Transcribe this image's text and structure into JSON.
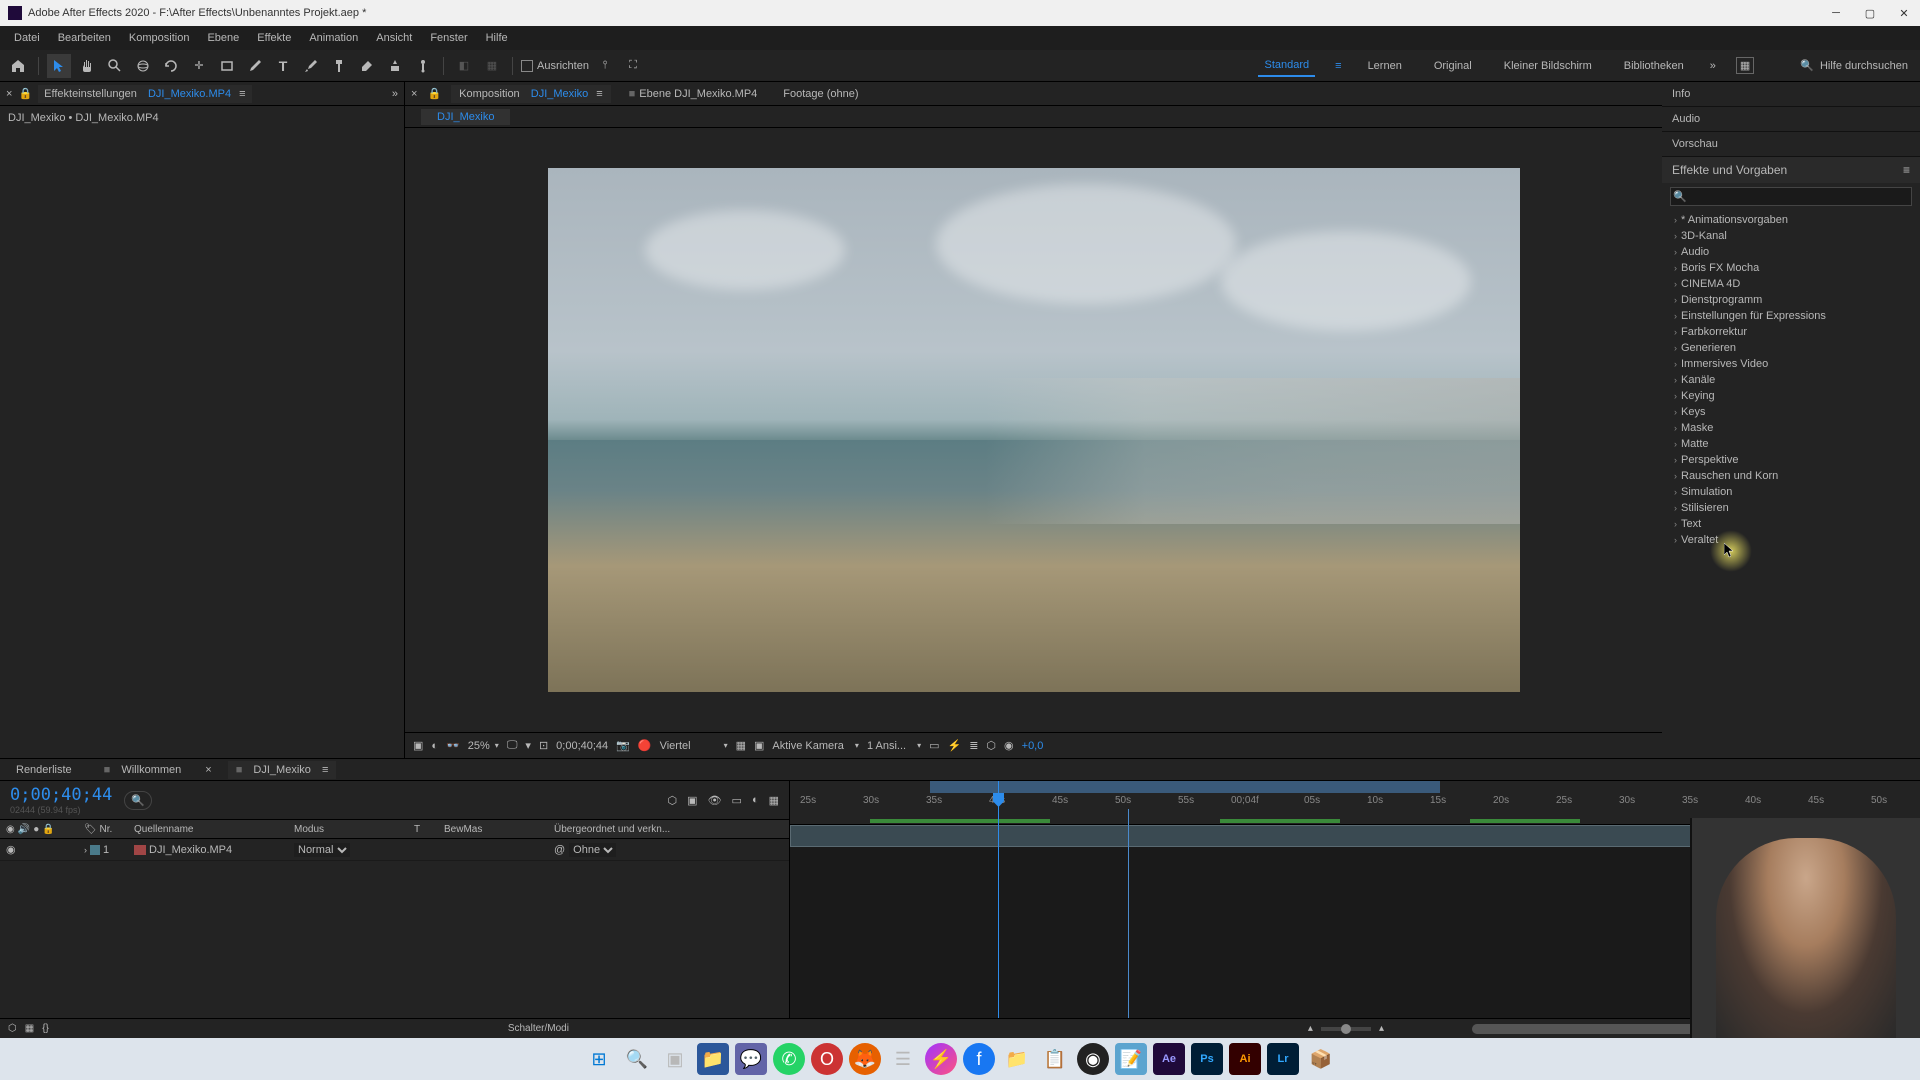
{
  "titlebar": {
    "title": "Adobe After Effects 2020 - F:\\After Effects\\Unbenanntes Projekt.aep *"
  },
  "menu": {
    "items": [
      "Datei",
      "Bearbeiten",
      "Komposition",
      "Ebene",
      "Effekte",
      "Animation",
      "Ansicht",
      "Fenster",
      "Hilfe"
    ]
  },
  "toolbar": {
    "snapping": "Ausrichten",
    "workspaces": [
      "Standard",
      "Lernen",
      "Original",
      "Kleiner Bildschirm",
      "Bibliotheken"
    ],
    "search_placeholder": "Hilfe durchsuchen"
  },
  "left_panel": {
    "tab1_prefix": "Effekteinstellungen",
    "tab1_file": "DJI_Mexiko.MP4",
    "breadcrumb": "DJI_Mexiko • DJI_Mexiko.MP4"
  },
  "comp_panel": {
    "tab_comp_prefix": "Komposition",
    "tab_comp_file": "DJI_Mexiko",
    "tab_layer": "Ebene DJI_Mexiko.MP4",
    "tab_footage": "Footage  (ohne)",
    "sub_tab": "DJI_Mexiko"
  },
  "viewer_controls": {
    "zoom": "25%",
    "timecode": "0;00;40;44",
    "resolution": "Viertel",
    "camera": "Aktive Kamera",
    "views": "1 Ansi...",
    "exposure": "+0,0"
  },
  "right_panel": {
    "sections": [
      "Info",
      "Audio",
      "Vorschau"
    ],
    "effects_header": "Effekte und Vorgaben",
    "categories": [
      "* Animationsvorgaben",
      "3D-Kanal",
      "Audio",
      "Boris FX Mocha",
      "CINEMA 4D",
      "Dienstprogramm",
      "Einstellungen für Expressions",
      "Farbkorrektur",
      "Generieren",
      "Immersives Video",
      "Kanäle",
      "Keying",
      "Keys",
      "Maske",
      "Matte",
      "Perspektive",
      "Rauschen und Korn",
      "Simulation",
      "Stilisieren",
      "Text",
      "Veraltet"
    ]
  },
  "timeline": {
    "tabs": {
      "render": "Renderliste",
      "welcome": "Willkommen",
      "comp": "DJI_Mexiko"
    },
    "timecode": "0;00;40;44",
    "sub_timecode": "02444 (59.94 fps)",
    "columns": {
      "nr": "Nr.",
      "name": "Quellenname",
      "mode": "Modus",
      "t": "T",
      "track": "BewMas",
      "parent": "Übergeordnet und verkn..."
    },
    "layer": {
      "num": "1",
      "name": "DJI_Mexiko.MP4",
      "mode": "Normal",
      "parent": "Ohne"
    },
    "footer": "Schalter/Modi",
    "ticks": [
      "25s",
      "30s",
      "35s",
      "40s",
      "45s",
      "50s",
      "55s",
      "00;04f",
      "05s",
      "10s",
      "15s",
      "20s",
      "25s",
      "30s",
      "35s",
      "40s",
      "45s",
      "50s"
    ]
  },
  "taskbar": {
    "icons": [
      "windows",
      "search",
      "task-view",
      "explorer",
      "teams",
      "whatsapp",
      "opera",
      "firefox",
      "app7",
      "messenger",
      "facebook",
      "folder",
      "app8",
      "obs",
      "notepad",
      "ae",
      "ps",
      "ai",
      "lr",
      "app9"
    ]
  }
}
